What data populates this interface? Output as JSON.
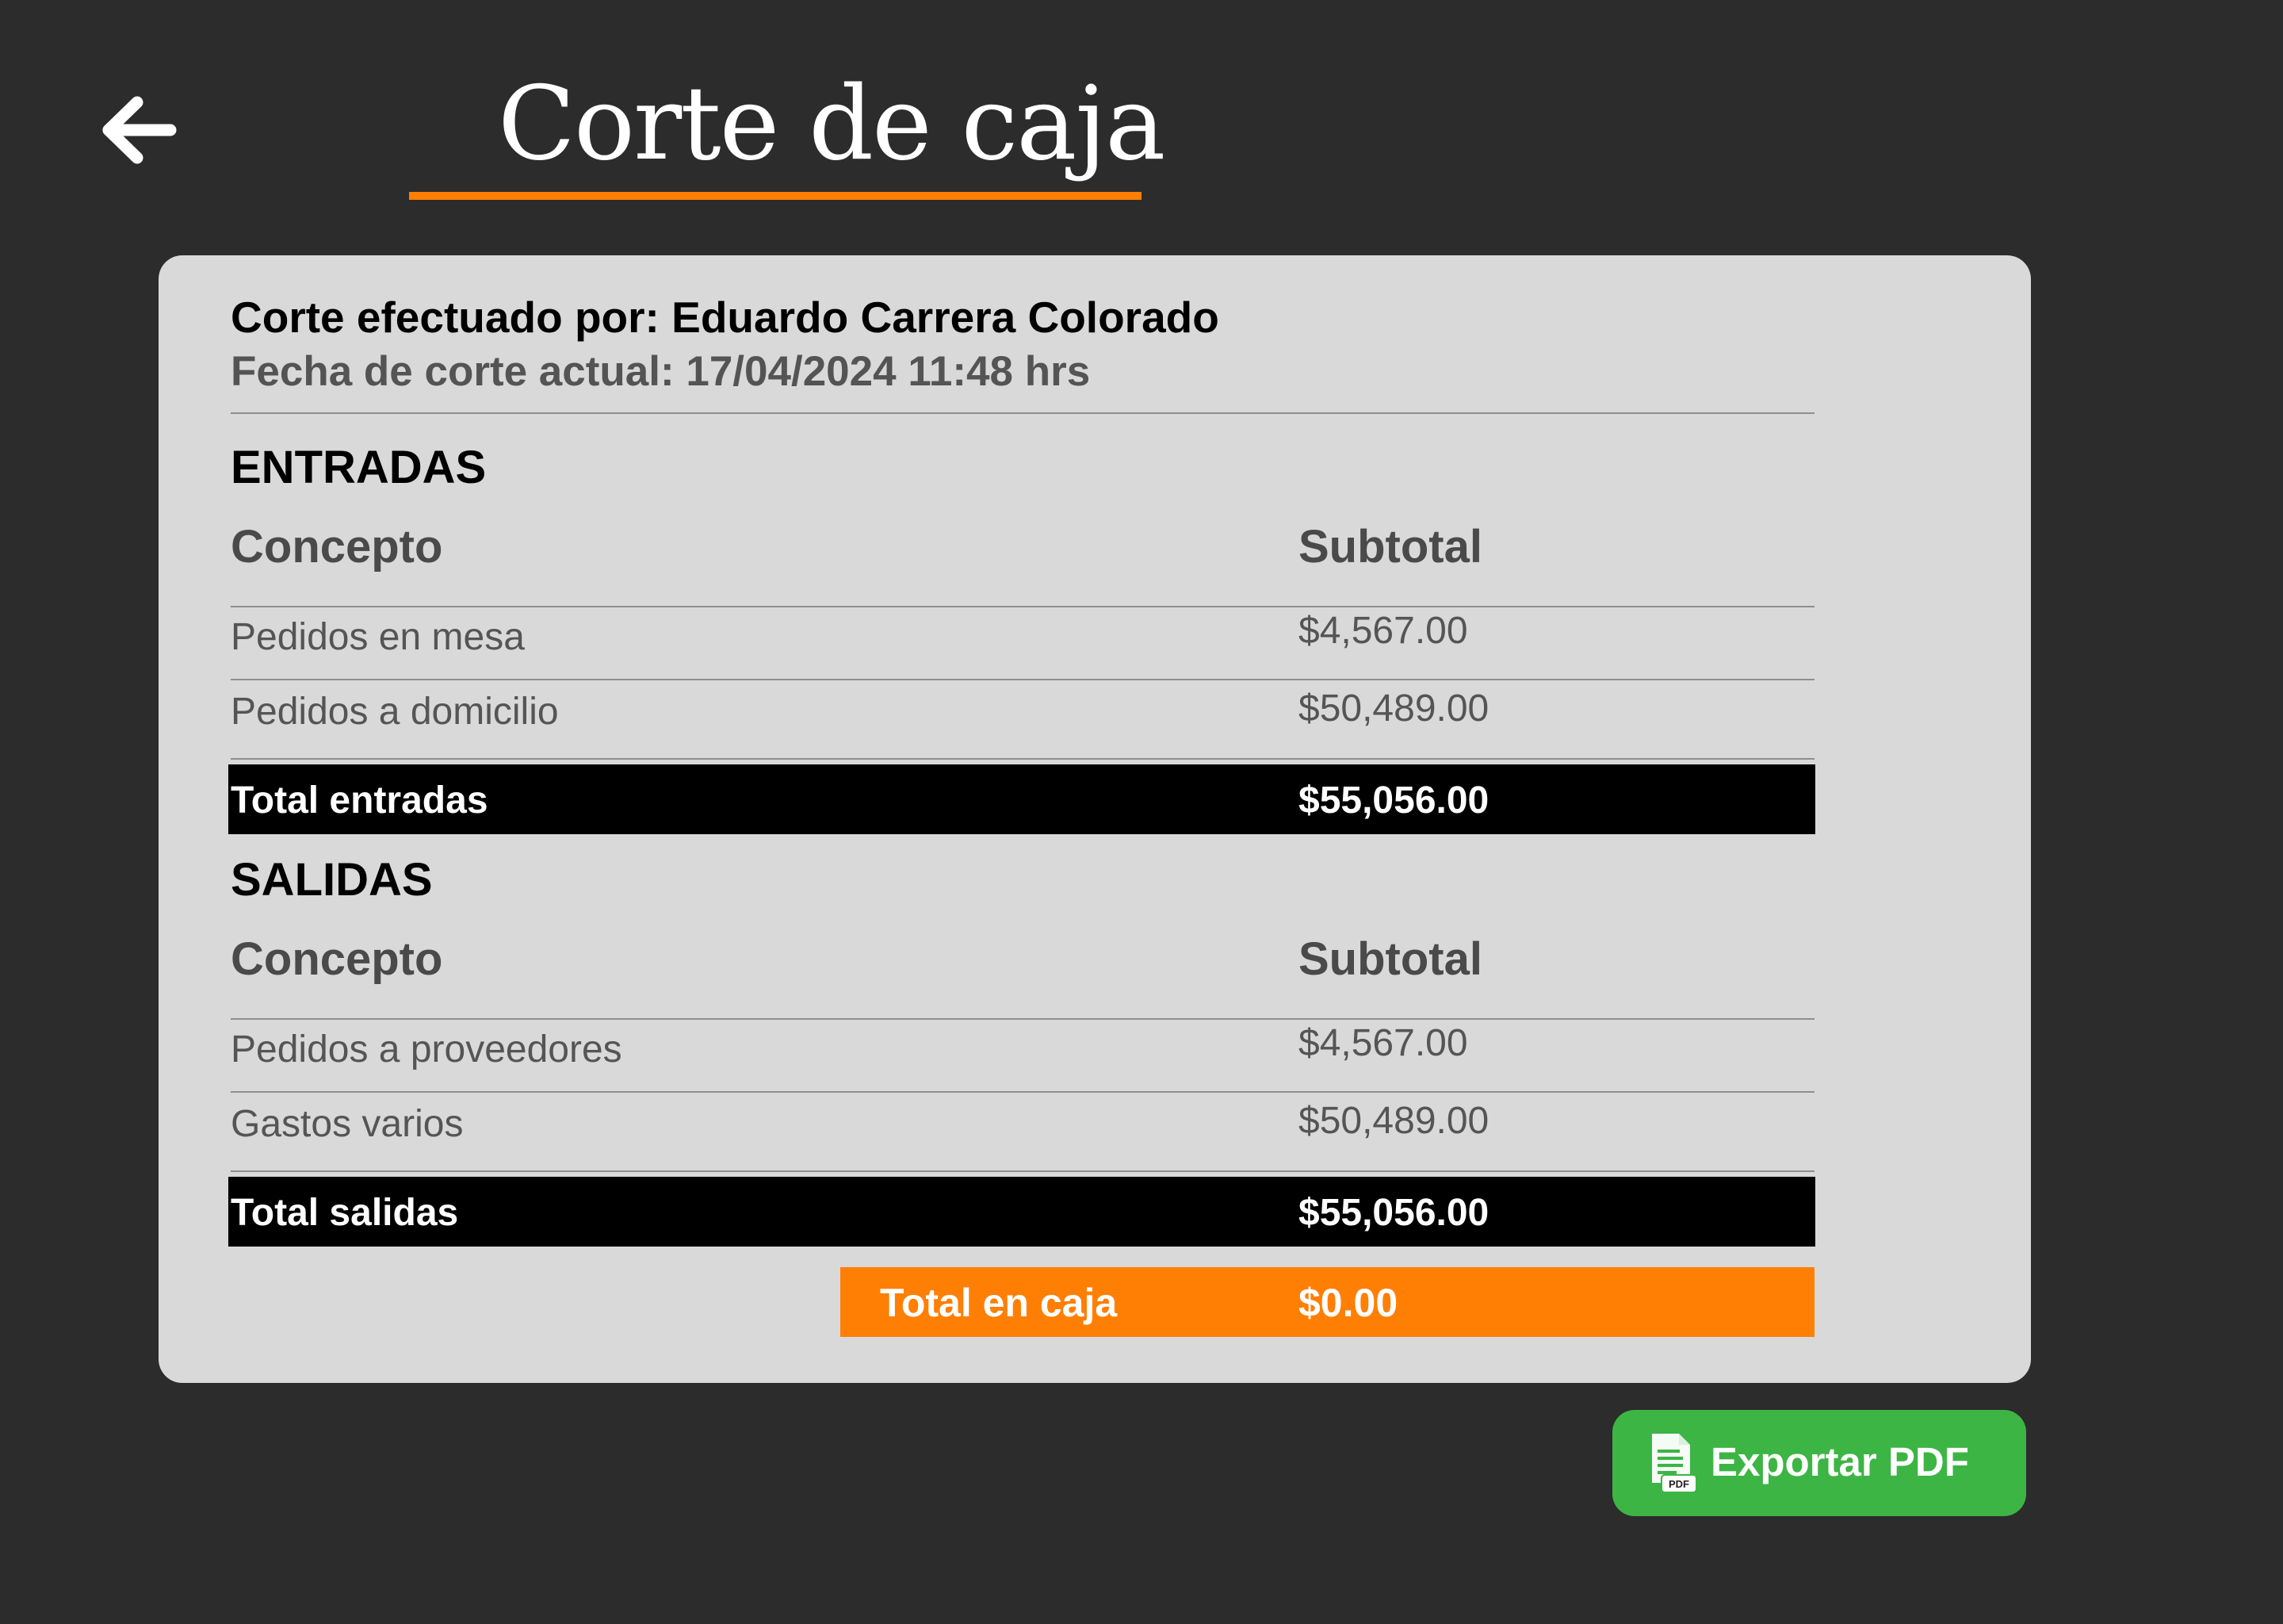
{
  "header": {
    "title": "Corte de caja"
  },
  "report": {
    "performed_by": "Corte efectuado por: Eduardo Carrera Colorado",
    "date_line": "Fecha de corte actual: 17/04/2024 11:48 hrs",
    "entradas": {
      "title": "ENTRADAS",
      "col_concept": "Concepto",
      "col_subtotal": "Subtotal",
      "rows": [
        {
          "concept": "Pedidos en mesa",
          "subtotal": "$4,567.00"
        },
        {
          "concept": "Pedidos a domicilio",
          "subtotal": "$50,489.00"
        }
      ],
      "total_label": "Total entradas",
      "total_value": "$55,056.00"
    },
    "salidas": {
      "title": "SALIDAS",
      "col_concept": "Concepto",
      "col_subtotal": "Subtotal",
      "rows": [
        {
          "concept": "Pedidos a proveedores",
          "subtotal": "$4,567.00"
        },
        {
          "concept": "Gastos varios",
          "subtotal": "$50,489.00"
        }
      ],
      "total_label": "Total salidas",
      "total_value": "$55,056.00"
    },
    "grand_total_label": "Total en caja",
    "grand_total_value": "$0.00"
  },
  "actions": {
    "export_label": "Exportar PDF",
    "export_icon": "pdf-file-icon",
    "export_icon_badge": "PDF",
    "back_icon": "arrow-left-icon"
  },
  "colors": {
    "background": "#2c2c2c",
    "card": "#d9d9d9",
    "accent_orange": "#ff7f05",
    "export_green": "#3cb544",
    "total_bar": "#000000"
  }
}
